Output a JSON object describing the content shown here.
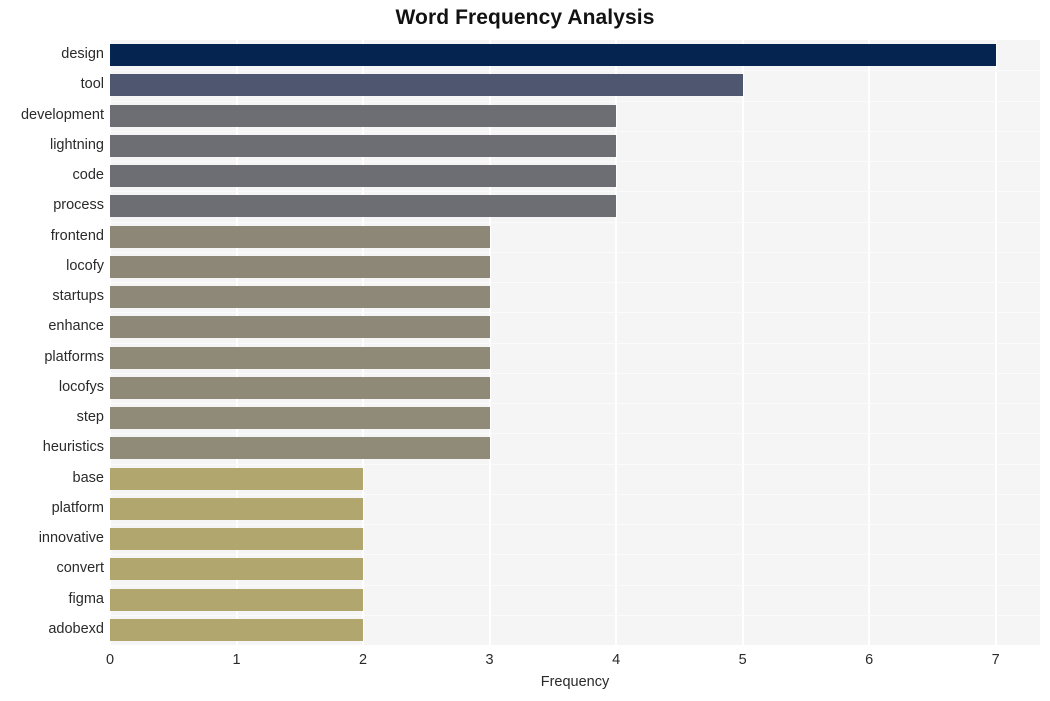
{
  "chart_data": {
    "type": "bar",
    "orientation": "horizontal",
    "title": "Word Frequency Analysis",
    "xlabel": "Frequency",
    "ylabel": "",
    "xlim": [
      0,
      7.35
    ],
    "xticks": [
      0,
      1,
      2,
      3,
      4,
      5,
      6,
      7
    ],
    "xtick_labels": [
      "0",
      "1",
      "2",
      "3",
      "4",
      "5",
      "6",
      "7"
    ],
    "grid": "vertical-white",
    "legend": "none",
    "categories": [
      "design",
      "tool",
      "development",
      "lightning",
      "code",
      "process",
      "frontend",
      "locofy",
      "startups",
      "enhance",
      "platforms",
      "locofys",
      "step",
      "heuristics",
      "base",
      "platform",
      "innovative",
      "convert",
      "figma",
      "adobexd"
    ],
    "values": [
      7,
      5,
      4,
      4,
      4,
      4,
      3,
      3,
      3,
      3,
      3,
      3,
      3,
      3,
      2,
      2,
      2,
      2,
      2,
      2
    ],
    "bar_colors": [
      "#062450",
      "#4f5670",
      "#6d6e73",
      "#6d6e73",
      "#6d6e73",
      "#6d6e73",
      "#8d8777",
      "#8d8777",
      "#8e8878",
      "#8e8878",
      "#8f8978",
      "#8f8978",
      "#908a79",
      "#908a79",
      "#b0a66e",
      "#b0a66e",
      "#b0a66e",
      "#b0a66e",
      "#b0a66e",
      "#b0a66e"
    ]
  },
  "style": {
    "plot_background": "#f5f5f6",
    "figure_background": "#ffffff",
    "gridline_color": "#ffffff",
    "text_color": "#2a2a2a",
    "title_color": "#121212"
  }
}
